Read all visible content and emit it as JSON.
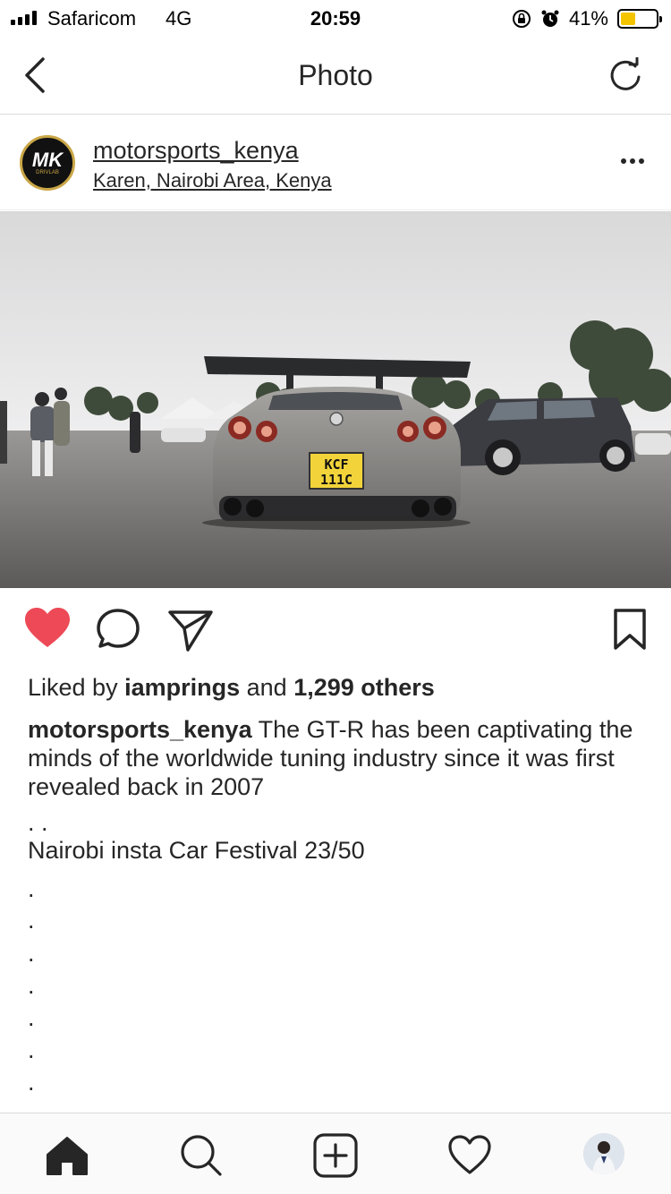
{
  "status": {
    "carrier": "Safaricom",
    "network": "4G",
    "time": "20:59",
    "battery_percent": "41%",
    "battery_level": 0.41,
    "battery_color": "#f5c400"
  },
  "nav": {
    "title": "Photo",
    "back_icon": "chevron-left-icon",
    "refresh_icon": "refresh-icon"
  },
  "post": {
    "avatar_text": "MK",
    "avatar_subtext": "DRIVLAB",
    "username": "motorsports_kenya",
    "location": "Karen, Nairobi Area, Kenya",
    "liked": true,
    "like_color": "#ed4956",
    "likes": {
      "prefix": "Liked by",
      "user": "iamprings",
      "joiner": "and",
      "others": "1,299 others"
    },
    "caption": {
      "user": "motorsports_kenya",
      "text": "The GT-R has been captivating the minds of the worldwide tuning industry since it was first revealed back in 2007",
      "lines": [
        ". .",
        "Nairobi insta Car Festival 23/50",
        ".",
        ".",
        ".",
        ".",
        ".",
        ".",
        "."
      ]
    },
    "photo_plate": [
      "KCF",
      "111C"
    ]
  },
  "tabs": [
    "home-icon",
    "search-icon",
    "add-post-icon",
    "activity-heart-icon",
    "profile-avatar"
  ]
}
